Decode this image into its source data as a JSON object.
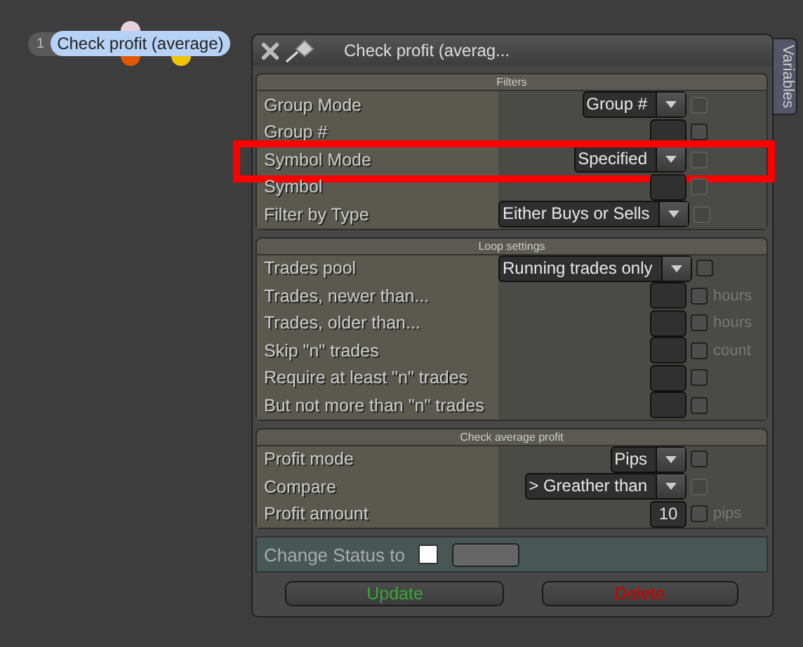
{
  "node": {
    "index": "1",
    "label": "Check profit (average)"
  },
  "dialog": {
    "title": "Check profit (averag...",
    "side_tab": "Variables"
  },
  "sections": [
    {
      "title": "Filters",
      "rows": [
        {
          "label": "Group Mode",
          "control": {
            "kind": "dropdown",
            "value": "Group #"
          },
          "checkbox": {
            "checked": false,
            "disabled": true
          }
        },
        {
          "label": "Group #",
          "control": {
            "kind": "input"
          },
          "checkbox": {
            "checked": false,
            "disabled": false
          }
        },
        {
          "label": "Symbol Mode",
          "control": {
            "kind": "dropdown",
            "value": "Specified"
          },
          "checkbox": {
            "checked": false,
            "disabled": true
          },
          "highlighted": true
        },
        {
          "label": "Symbol",
          "control": {
            "kind": "input"
          },
          "checkbox": {
            "checked": false,
            "disabled": true
          }
        },
        {
          "label": "Filter by Type",
          "control": {
            "kind": "dropdown",
            "value": "Either Buys or Sells"
          },
          "checkbox": {
            "checked": false,
            "disabled": true
          }
        }
      ]
    },
    {
      "title": "Loop settings",
      "rows": [
        {
          "label": "Trades pool",
          "control": {
            "kind": "dropdown",
            "value": "Running trades only"
          },
          "checkbox": {
            "checked": false,
            "disabled": false
          }
        },
        {
          "label": "Trades, newer than...",
          "control": {
            "kind": "input"
          },
          "checkbox": {
            "checked": false,
            "disabled": false
          },
          "unit": "hours"
        },
        {
          "label": "Trades, older than...",
          "control": {
            "kind": "input"
          },
          "checkbox": {
            "checked": false,
            "disabled": false
          },
          "unit": "hours"
        },
        {
          "label": "Skip \"n\" trades",
          "control": {
            "kind": "input"
          },
          "checkbox": {
            "checked": false,
            "disabled": false
          },
          "unit": "count"
        },
        {
          "label": "Require at least \"n\" trades",
          "control": {
            "kind": "input"
          },
          "checkbox": {
            "checked": false,
            "disabled": false
          }
        },
        {
          "label": "But not more than \"n\" trades",
          "control": {
            "kind": "input"
          },
          "checkbox": {
            "checked": false,
            "disabled": false
          }
        }
      ]
    },
    {
      "title": "Check average profit",
      "rows": [
        {
          "label": "Profit mode",
          "control": {
            "kind": "dropdown",
            "value": "Pips"
          },
          "checkbox": {
            "checked": false,
            "disabled": false
          }
        },
        {
          "label": "Compare",
          "control": {
            "kind": "dropdown",
            "value": "> Greather than"
          },
          "checkbox": {
            "checked": false,
            "disabled": true
          }
        },
        {
          "label": "Profit amount",
          "control": {
            "kind": "input",
            "value": "10"
          },
          "checkbox": {
            "checked": false,
            "disabled": false
          },
          "unit": "pips"
        }
      ]
    }
  ],
  "status": {
    "label": "Change Status to",
    "checked": false
  },
  "buttons": [
    {
      "label": "Update",
      "kind": "confirm"
    },
    {
      "label": "Delete",
      "kind": "danger"
    }
  ]
}
